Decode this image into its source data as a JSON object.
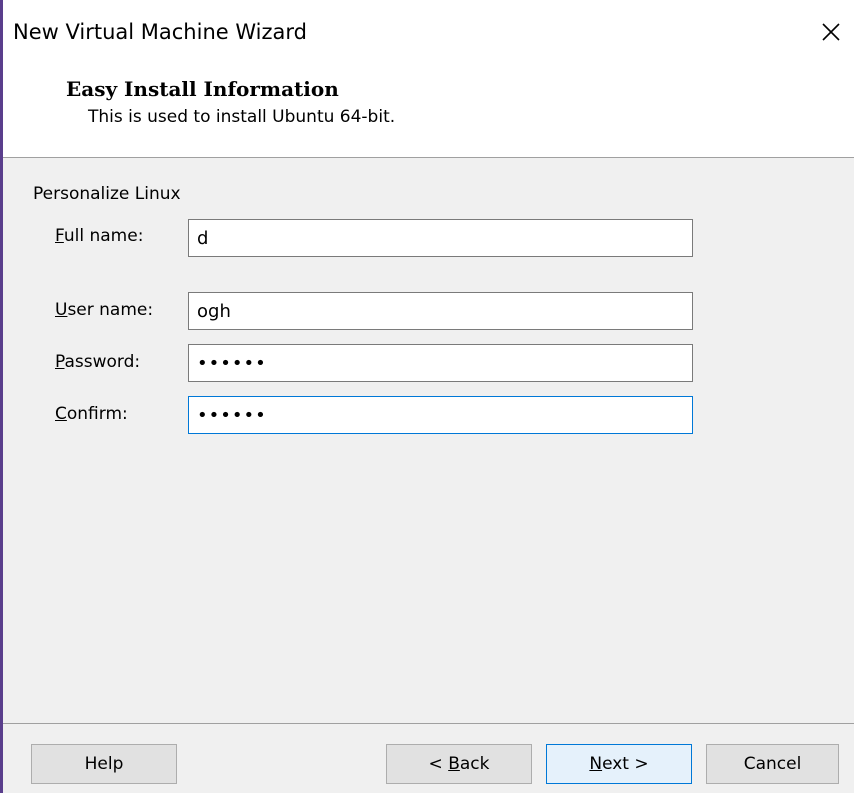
{
  "window": {
    "title": "New Virtual Machine Wizard",
    "close_icon": "close-icon"
  },
  "header": {
    "title": "Easy Install Information",
    "subtitle": "This is used to install Ubuntu 64-bit."
  },
  "form": {
    "group_label": "Personalize Linux",
    "full_name": {
      "label_mnemonic": "F",
      "label_rest": "ull name:",
      "value": "d"
    },
    "user_name": {
      "label_mnemonic": "U",
      "label_rest": "ser name:",
      "value": "ogh"
    },
    "password": {
      "label_mnemonic": "P",
      "label_rest": "assword:",
      "value": "••••••"
    },
    "confirm": {
      "label_mnemonic": "C",
      "label_rest": "onfirm:",
      "value": "••••••"
    }
  },
  "buttons": {
    "help": "Help",
    "back_prefix": "< ",
    "back_mnemonic": "B",
    "back_rest": "ack",
    "next_mnemonic": "N",
    "next_rest": "ext >",
    "cancel": "Cancel"
  },
  "colors": {
    "accent": "#0078d7",
    "body_bg": "#f0f0f0",
    "left_edge": "#5a3e8c"
  }
}
